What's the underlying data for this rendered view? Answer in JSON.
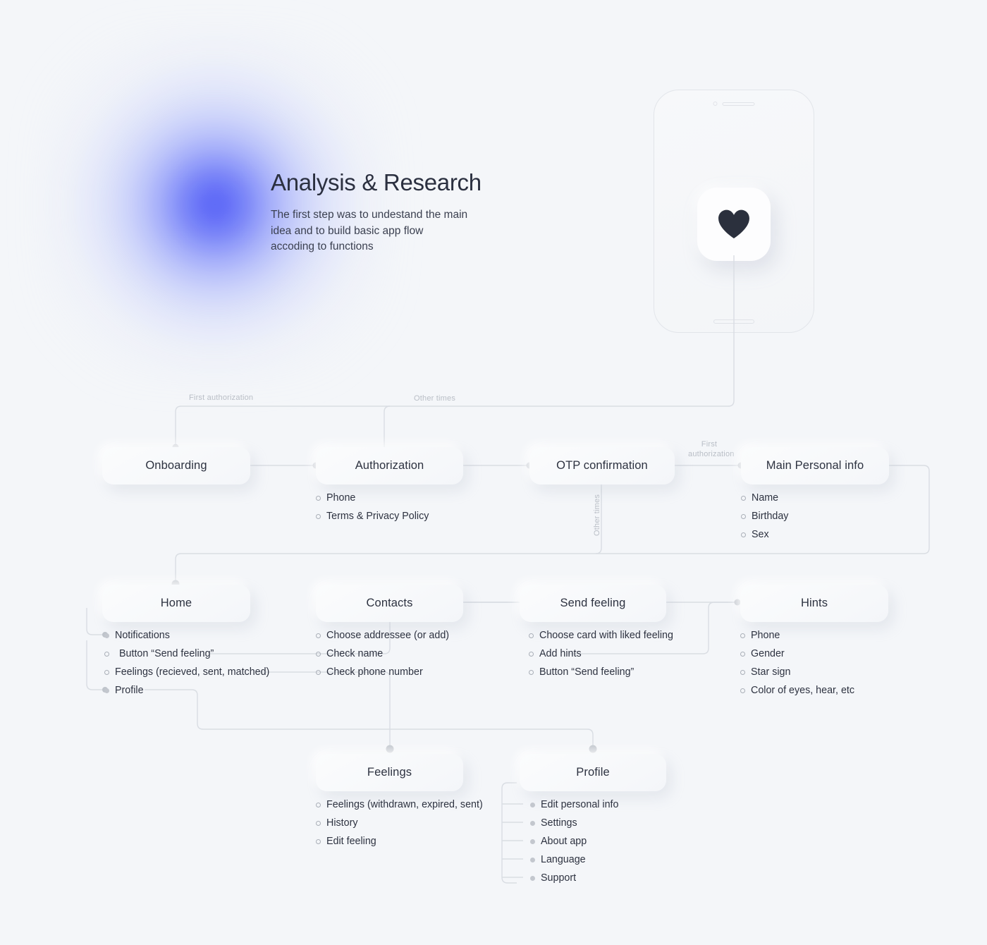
{
  "page": {
    "background_color": "#f4f6f9",
    "accent_color": "#3a47f5",
    "title": "Analysis & Research",
    "subtitle": "The first step was to undestand the main\nidea and to build basic app flow\naccoding to functions"
  },
  "intro": {
    "heading": "Analysis & Research",
    "body_line1": "The first step was to undestand the main",
    "body_line2": "idea and to build basic app flow",
    "body_line3": "accoding to functions"
  },
  "phone": {
    "app_icon": "heart-icon",
    "icon_color": "#2b303d"
  },
  "wire_labels": {
    "first_authorization": "First authorization",
    "other_times_top": "Other times",
    "first_authorization_2": "First\nauthorization",
    "first_authorization_2_line1": "First",
    "first_authorization_2_line2": "authorization",
    "other_times_vertical": "Other times"
  },
  "flow": {
    "nodes": [
      {
        "id": "onboarding",
        "label": "Onboarding",
        "items": []
      },
      {
        "id": "authorization",
        "label": "Authorization",
        "items": [
          {
            "text": "Phone",
            "marker": "ring"
          },
          {
            "text": "Terms & Privacy Policy",
            "marker": "ring"
          }
        ]
      },
      {
        "id": "otp-confirmation",
        "label": "OTP confirmation",
        "items": []
      },
      {
        "id": "main-personal-info",
        "label": "Main Personal info",
        "items": [
          {
            "text": "Name",
            "marker": "ring"
          },
          {
            "text": "Birthday",
            "marker": "ring"
          },
          {
            "text": "Sex",
            "marker": "ring"
          }
        ]
      },
      {
        "id": "home",
        "label": "Home",
        "items": [
          {
            "text": "Notifications",
            "marker": "dot"
          },
          {
            "text": "Button “Send feeling”",
            "marker": "ring"
          },
          {
            "text": "Feelings (recieved, sent, matched)",
            "marker": "ring"
          },
          {
            "text": "Profile",
            "marker": "dot"
          }
        ]
      },
      {
        "id": "contacts",
        "label": "Contacts",
        "items": [
          {
            "text": "Choose addressee (or add)",
            "marker": "ring"
          },
          {
            "text": "Check name",
            "marker": "ring"
          },
          {
            "text": "Check phone number",
            "marker": "ring"
          }
        ]
      },
      {
        "id": "send-feeling",
        "label": "Send feeling",
        "items": [
          {
            "text": "Choose card with liked feeling",
            "marker": "ring"
          },
          {
            "text": "Add hints",
            "marker": "ring"
          },
          {
            "text": "Button “Send feeling”",
            "marker": "ring"
          }
        ]
      },
      {
        "id": "hints",
        "label": "Hints",
        "items": [
          {
            "text": "Phone",
            "marker": "ring"
          },
          {
            "text": "Gender",
            "marker": "ring"
          },
          {
            "text": "Star sign",
            "marker": "ring"
          },
          {
            "text": "Color of eyes, hear, etc",
            "marker": "ring"
          }
        ]
      },
      {
        "id": "feelings",
        "label": "Feelings",
        "items": [
          {
            "text": "Feelings (withdrawn, expired, sent)",
            "marker": "ring"
          },
          {
            "text": "History",
            "marker": "ring"
          },
          {
            "text": "Edit feeling",
            "marker": "ring"
          }
        ]
      },
      {
        "id": "profile",
        "label": "Profile",
        "items": [
          {
            "text": "Edit personal info",
            "marker": "dot"
          },
          {
            "text": "Settings",
            "marker": "dot"
          },
          {
            "text": "About app",
            "marker": "dot"
          },
          {
            "text": "Language",
            "marker": "dot"
          },
          {
            "text": "Support",
            "marker": "dot"
          }
        ]
      }
    ]
  }
}
